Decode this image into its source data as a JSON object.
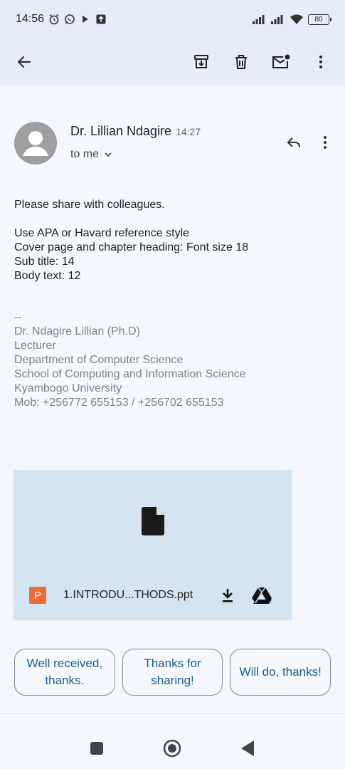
{
  "status_bar": {
    "time": "14:56",
    "battery": "80"
  },
  "app_bar": {
    "back_icon": "arrow-left-icon",
    "archive_icon": "archive-icon",
    "delete_icon": "trash-icon",
    "mark_unread_icon": "mail-unread-icon",
    "more_icon": "more-vertical-icon"
  },
  "message": {
    "sender": "Dr. Lillian Ndagire",
    "time": "14:27",
    "recipient": "to me",
    "body": "Please share with colleagues.\n\nUse APA or Havard reference style\nCover page and chapter heading: Font size 18\nSub title: 14\nBody text: 12",
    "signature": "--\nDr. Ndagire Lillian (Ph.D)\nLecturer\nDepartment of Computer Science\nSchool of Computing and Information Science\nKyambogo University\nMob: +256772 655153 / +256702 655153"
  },
  "attachment": {
    "type_badge": "P",
    "file_name": "1.INTRODU...THODS.ppt",
    "badge_color": "#ed6c3a"
  },
  "smart_replies": [
    {
      "label": "Well received, thanks."
    },
    {
      "label": "Thanks for sharing!"
    },
    {
      "label": "Will do, thanks!"
    }
  ],
  "colors": {
    "app_bar_bg": "#e7edf6",
    "page_bg": "#f4f7fc",
    "attachment_bg": "#d4e4f3",
    "signature_text": "#808080"
  }
}
